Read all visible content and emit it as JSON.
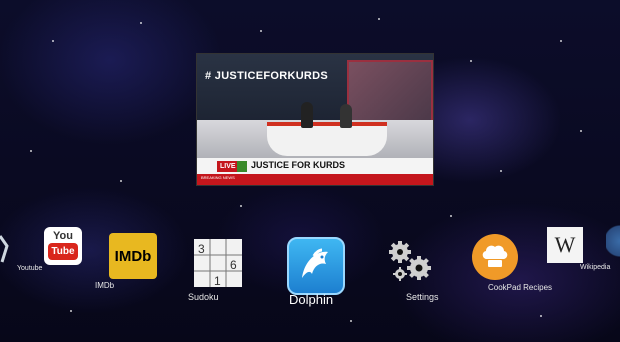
{
  "preview": {
    "hashtag": "# JUSTICEFORKURDS",
    "live_badge": "LIVE",
    "headline": "JUSTICE FOR KURDS",
    "strap_text": "BREAKING NEWS"
  },
  "apps": {
    "youtube": {
      "label": "Youtube",
      "icon": "youtube-icon",
      "icon_top": "You",
      "icon_bottom": "Tube"
    },
    "imdb": {
      "label": "IMDb",
      "icon": "imdb-icon",
      "icon_text": "IMDb"
    },
    "sudoku": {
      "label": "Sudoku",
      "icon": "sudoku-grid-icon",
      "digits": [
        "3",
        "6",
        "1"
      ]
    },
    "dolphin": {
      "label": "Dolphin",
      "icon": "dolphin-icon",
      "selected": true
    },
    "settings": {
      "label": "Settings",
      "icon": "gears-icon"
    },
    "cookpad": {
      "label": "CookPad Recipes",
      "icon": "chef-hat-icon"
    },
    "wikipedia": {
      "label": "Wikipedia",
      "icon": "wikipedia-icon",
      "icon_text": "W"
    }
  },
  "colors": {
    "background": "#0a0a22",
    "youtube_red": "#d9261c",
    "imdb_yellow": "#e8b820",
    "dolphin_blue": "#3fb7f2",
    "cookpad_orange": "#f09a28"
  }
}
